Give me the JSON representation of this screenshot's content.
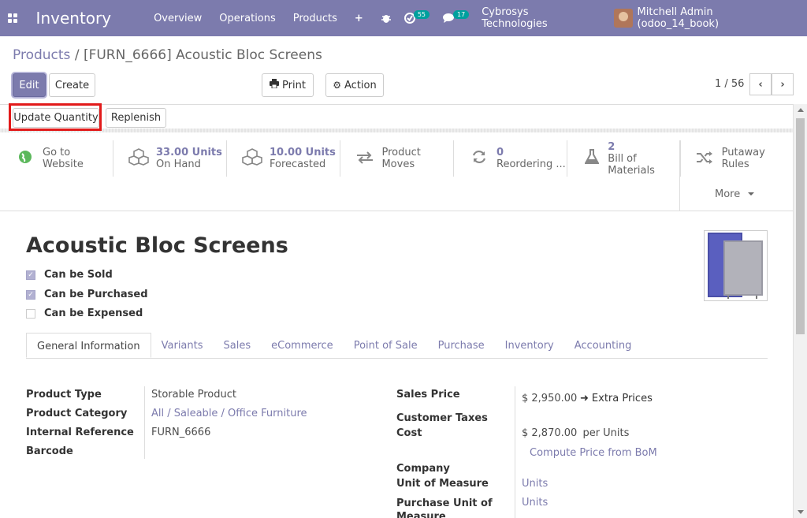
{
  "navbar": {
    "brand": "Inventory",
    "menu": [
      "Overview",
      "Operations",
      "Products"
    ],
    "plus": "+",
    "activity_badge": "55",
    "messages_badge": "17",
    "company": "Cybrosys Technologies",
    "user": "Mitchell Admin (odoo_14_book)"
  },
  "breadcrumb": {
    "parent": "Products",
    "separator": "/",
    "current": "[FURN_6666] Acoustic Bloc Screens"
  },
  "controls": {
    "edit": "Edit",
    "create": "Create",
    "print": "Print",
    "action": "Action",
    "pager": "1 / 56"
  },
  "header_buttons": {
    "update_quantity": "Update Quantity",
    "replenish": "Replenish"
  },
  "smart_buttons": [
    {
      "value": "Go to",
      "label": "Website",
      "icon": "globe-icon"
    },
    {
      "value": "33.00 Units",
      "label": "On Hand",
      "icon": "cubes-icon"
    },
    {
      "value": "10.00 Units",
      "label": "Forecasted",
      "icon": "cubes-icon"
    },
    {
      "value": "",
      "label": "Product Moves",
      "icon": "exchange-icon"
    },
    {
      "value": "0",
      "label": "Reordering ...",
      "icon": "refresh-icon"
    },
    {
      "value": "2",
      "label": "Bill of Materials",
      "icon": "flask-icon"
    },
    {
      "value": "",
      "label": "Putaway Rules",
      "icon": "random-icon"
    }
  ],
  "more": "More",
  "product": {
    "name": "Acoustic Bloc Screens",
    "can_be_sold": "Can be Sold",
    "can_be_purchased": "Can be Purchased",
    "can_be_expensed": "Can be Expensed"
  },
  "tabs": [
    "General Information",
    "Variants",
    "Sales",
    "eCommerce",
    "Point of Sale",
    "Purchase",
    "Inventory",
    "Accounting"
  ],
  "fields": {
    "product_type_label": "Product Type",
    "product_type": "Storable Product",
    "product_category_label": "Product Category",
    "product_category": "All / Saleable / Office Furniture",
    "internal_ref_label": "Internal Reference",
    "internal_ref": "FURN_6666",
    "barcode_label": "Barcode",
    "sales_price_label": "Sales Price",
    "sales_price": "$ 2,950.00",
    "extra_prices": "Extra Prices",
    "customer_taxes_label": "Customer Taxes",
    "cost_label": "Cost",
    "cost": "$ 2,870.00",
    "cost_unit": "per Units",
    "compute_price": "Compute Price from BoM",
    "company_label": "Company",
    "uom_label": "Unit of Measure",
    "uom": "Units",
    "purchase_uom_label": "Purchase Unit of Measure",
    "purchase_uom": "Units"
  },
  "colors": {
    "primary": "#7c7bad",
    "highlight": "#e21a1a"
  }
}
